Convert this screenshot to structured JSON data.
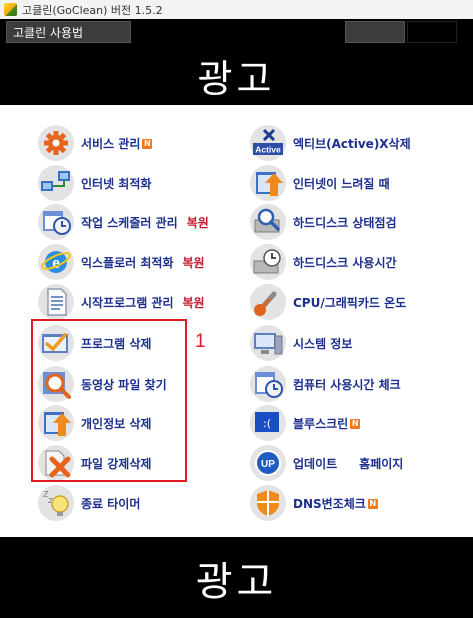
{
  "window": {
    "title": "고클린(GoClean) 버전 1.5.2"
  },
  "menubar": {
    "usage_label": "고클린 사용법"
  },
  "ads": {
    "top": "광고",
    "bottom": "광고"
  },
  "badge_text": "N",
  "left_column": [
    {
      "label": "서비스 관리",
      "icon": "gear-icon",
      "badge": true
    },
    {
      "label": "인터넷 최적화",
      "icon": "network-icon"
    },
    {
      "label": "작업 스케줄러 관리",
      "icon": "scheduler-clock-icon",
      "restore": "복원"
    },
    {
      "label": "익스플로러 최적화",
      "icon": "internet-explorer-icon",
      "restore": "복원"
    },
    {
      "label": "시작프로그램 관리",
      "icon": "startup-document-icon",
      "restore": "복원"
    },
    {
      "label": "프로그램 삭제",
      "icon": "program-uninstall-icon"
    },
    {
      "label": "동영상 파일 찾기",
      "icon": "magnifier-icon"
    },
    {
      "label": "개인정보 삭제",
      "icon": "privacy-icon"
    },
    {
      "label": "파일 강제삭제",
      "icon": "file-delete-icon"
    },
    {
      "label": "종료 타이머",
      "icon": "sleep-timer-icon"
    }
  ],
  "right_column": [
    {
      "label": "엑티브(Active)X삭제",
      "icon": "activex-icon"
    },
    {
      "label": "인터넷이 느려질 때",
      "icon": "slow-internet-icon"
    },
    {
      "label": "하드디스크 상태점검",
      "icon": "disk-check-icon"
    },
    {
      "label": "하드디스크 사용시간",
      "icon": "disk-time-icon"
    },
    {
      "label": "CPU/그래픽카드 온도",
      "icon": "temperature-icon"
    },
    {
      "label": "시스템 정보",
      "icon": "system-info-icon"
    },
    {
      "label": "컴퓨터 사용시간 체크",
      "icon": "computer-time-icon"
    },
    {
      "label": "블루스크린",
      "icon": "bluescreen-icon",
      "badge": true
    },
    {
      "label": "업데이트",
      "icon": "update-icon",
      "homepage": "홈페이지"
    },
    {
      "label": "DNS변조체크",
      "icon": "dns-shield-icon",
      "badge": true
    }
  ],
  "annotation": {
    "number": "1",
    "color": "#e01b24"
  },
  "colors": {
    "label": "#1c2f8e",
    "restore": "#c41a2b",
    "badge": "#f0781e",
    "ad_bg": "#000000"
  }
}
